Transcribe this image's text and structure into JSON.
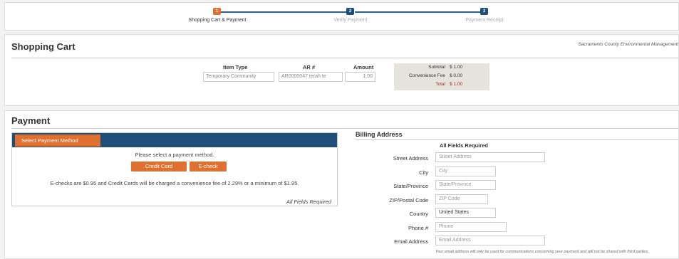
{
  "steps": [
    {
      "number": "1",
      "label": "Shopping Cart & Payment"
    },
    {
      "number": "2",
      "label": "Verify Payment"
    },
    {
      "number": "3",
      "label": "Payment Receipt"
    }
  ],
  "cart": {
    "title": "Shopping Cart",
    "agency": "Sacramento County Environmental Management",
    "columns": {
      "item_type": "Item Type",
      "ar": "AR #",
      "amount": "Amount"
    },
    "row": {
      "item_type": "Temporary Community",
      "ar": "AR0000047 terah te",
      "amount": "1.00"
    },
    "totals": {
      "subtotal_label": "Subtotal",
      "subtotal": "$ 1.00",
      "fee_label": "Convenience Fee",
      "fee": "$ 0.00",
      "total_label": "Total",
      "total": "$ 1.00"
    }
  },
  "payment": {
    "title": "Payment",
    "method_tab": "Select Payment Method",
    "prompt": "Please select a payment method.",
    "credit_card": "Credit Card",
    "echeck": "E-check",
    "fee_note": "E-checks are $0.95 and Credit Cards will be charged a convenience fee of 2.29% or a minimum of $1.95.",
    "required": "All Fields Required"
  },
  "billing": {
    "title": "Billing Address",
    "required": "All Fields Required",
    "fields": {
      "street": {
        "label": "Street Address",
        "placeholder": "Street Address"
      },
      "city": {
        "label": "City",
        "placeholder": "City"
      },
      "state": {
        "label": "State/Province",
        "placeholder": "State/Province"
      },
      "zip": {
        "label": "ZIP/Postal Code",
        "placeholder": "ZIP Code"
      },
      "country": {
        "label": "Country",
        "value": "United States"
      },
      "phone": {
        "label": "Phone #",
        "placeholder": "Phone"
      },
      "email": {
        "label": "Email Address",
        "placeholder": "Email Address"
      }
    },
    "privacy": "Your email address will only be used for communications concerning your payment and will not be shared with third parties."
  },
  "colors": {
    "accent": "#e07030",
    "primary": "#1f4e79",
    "total_red": "#a0282e"
  }
}
